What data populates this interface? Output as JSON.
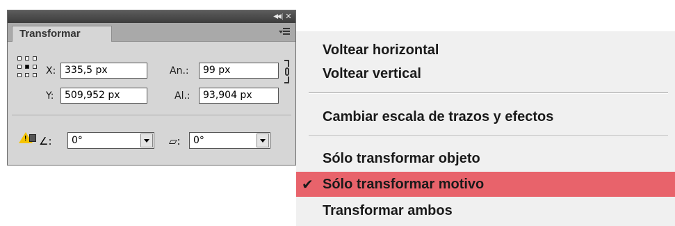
{
  "panel": {
    "tab_label": "Transformar",
    "x_label": "X:",
    "x_value": "335,5 px",
    "y_label": "Y:",
    "y_value": "509,952 px",
    "width_label": "An.:",
    "width_value": "99 px",
    "height_label": "Al.:",
    "height_value": "93,904 px",
    "rotate_value": "0°",
    "shear_value": "0°",
    "rotate_icon": "∠:",
    "shear_icon": "▱:"
  },
  "menu": {
    "flip_h": "Voltear horizontal",
    "flip_v": "Voltear vertical",
    "scale_strokes": "Cambiar escala de trazos y efectos",
    "transform_object": "Sólo transformar objeto",
    "transform_pattern": "Sólo transformar motivo",
    "transform_both": "Transformar ambos",
    "checkmark": "✔"
  },
  "colors": {
    "highlight": "#e8636b",
    "panel_bg": "#d6d6d6",
    "menu_bg": "#f0f0f0"
  }
}
